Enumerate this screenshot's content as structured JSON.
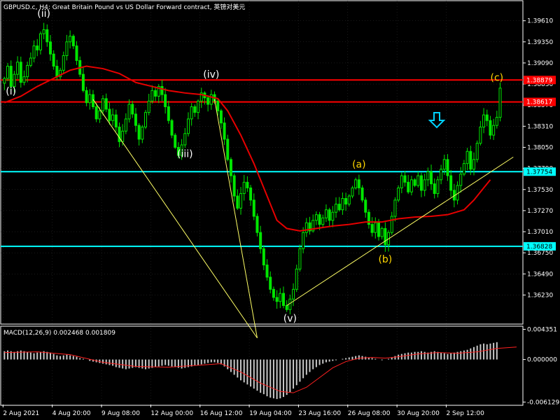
{
  "header": {
    "title": "GBPUSD.c, H4:  Great Britain Pound vs US Dollar Forward contract, 英镑对美元",
    "macd_label": "MACD(12,26,9) 0.002468 0.001809"
  },
  "colors": {
    "background": "#000000",
    "grid": "#333333",
    "frame": "#ffffff",
    "candle": "#00e600",
    "ma": "#e60000",
    "resistance": "#ff0000",
    "support": "#00ffff",
    "trend": "#ffff66",
    "wave_label_white": "#ffffff",
    "wave_label_yellow": "#ffd700",
    "arrow": "#00d2ff",
    "histogram": "#c8c8c8",
    "signal": "#ff2020"
  },
  "chart_data": {
    "type": "candlestick",
    "symbol": "GBPUSD.c",
    "timeframe": "H4",
    "price_axis": {
      "ylim": [
        1.3588,
        1.3984
      ],
      "ticks": [
        "1.39610",
        "1.39350",
        "1.39090",
        "1.38830",
        "1.38570",
        "1.38310",
        "1.38050",
        "1.37790",
        "1.37530",
        "1.37270",
        "1.37010",
        "1.36750",
        "1.36490",
        "1.36230"
      ]
    },
    "macd_axis": {
      "ylim": [
        -0.0065,
        0.0046
      ],
      "ticks": [
        "0.004351",
        "0.000000",
        "-0.006129"
      ]
    },
    "time_axis": {
      "labels": [
        "2 Aug 2021",
        "4 Aug 20:00",
        "9 Aug 08:00",
        "12 Aug 00:00",
        "16 Aug 12:00",
        "19 Aug 04:00",
        "23 Aug 16:00",
        "26 Aug 08:00",
        "30 Aug 20:00",
        "2 Sep 12:00"
      ]
    },
    "horizontal_lines": [
      {
        "price": 1.3888,
        "tag": "1.38879",
        "kind": "resistance"
      },
      {
        "price": 1.3861,
        "tag": "1.38617",
        "kind": "resistance"
      },
      {
        "price": 1.3775,
        "tag": "1.37754",
        "kind": "support"
      },
      {
        "price": 1.3683,
        "tag": "1.36828",
        "kind": "support"
      }
    ],
    "wave_labels": [
      {
        "text": "(i)",
        "index": 2,
        "price": 1.387,
        "color": "white"
      },
      {
        "text": "(ii)",
        "index": 12,
        "price": 1.3966,
        "color": "white"
      },
      {
        "text": "(iii)",
        "index": 55,
        "price": 1.3793,
        "color": "white"
      },
      {
        "text": "(iv)",
        "index": 63,
        "price": 1.3891,
        "color": "white"
      },
      {
        "text": "(v)",
        "index": 87,
        "price": 1.359,
        "color": "white"
      },
      {
        "text": "(a)",
        "index": 108,
        "price": 1.378,
        "color": "yellow"
      },
      {
        "text": "(b)",
        "index": 116,
        "price": 1.3663,
        "color": "yellow"
      },
      {
        "text": "(c)",
        "index": 150,
        "price": 1.3887,
        "color": "yellow"
      }
    ],
    "close": [
      1.389,
      1.3905,
      1.388,
      1.3895,
      1.391,
      1.3885,
      1.3892,
      1.3906,
      1.3915,
      1.393,
      1.3925,
      1.3945,
      1.395,
      1.3935,
      1.392,
      1.3905,
      1.3892,
      1.39,
      1.3918,
      1.3935,
      1.3942,
      1.393,
      1.3912,
      1.3895,
      1.3875,
      1.386,
      1.387,
      1.3855,
      1.384,
      1.385,
      1.3865,
      1.3852,
      1.3838,
      1.3845,
      1.383,
      1.3812,
      1.3825,
      1.384,
      1.3858,
      1.3846,
      1.3832,
      1.3815,
      1.383,
      1.3848,
      1.3862,
      1.3875,
      1.3868,
      1.388,
      1.387,
      1.3855,
      1.3838,
      1.382,
      1.3805,
      1.3795,
      1.3808,
      1.3822,
      1.384,
      1.3855,
      1.3848,
      1.3862,
      1.3872,
      1.3866,
      1.3858,
      1.387,
      1.3862,
      1.385,
      1.3835,
      1.3815,
      1.379,
      1.377,
      1.3745,
      1.373,
      1.3748,
      1.3762,
      1.3755,
      1.374,
      1.372,
      1.37,
      1.368,
      1.366,
      1.3645,
      1.363,
      1.362,
      1.3615,
      1.3625,
      1.361,
      1.3605,
      1.3618,
      1.363,
      1.3655,
      1.368,
      1.37,
      1.3712,
      1.3702,
      1.3715,
      1.3722,
      1.371,
      1.3718,
      1.3728,
      1.3715,
      1.3725,
      1.3735,
      1.3728,
      1.3742,
      1.3735,
      1.3745,
      1.3755,
      1.3765,
      1.3755,
      1.374,
      1.3725,
      1.371,
      1.37,
      1.3712,
      1.3695,
      1.3705,
      1.3685,
      1.37,
      1.372,
      1.374,
      1.3755,
      1.377,
      1.3762,
      1.375,
      1.3765,
      1.3758,
      1.377,
      1.3752,
      1.3765,
      1.3775,
      1.376,
      1.3748,
      1.3765,
      1.3778,
      1.379,
      1.377,
      1.3752,
      1.374,
      1.3758,
      1.3772,
      1.3785,
      1.38,
      1.3778,
      1.379,
      1.381,
      1.383,
      1.3845,
      1.3838,
      1.382,
      1.3832,
      1.3842,
      1.3878
    ],
    "ma_line": [
      [
        0,
        1.386
      ],
      [
        5,
        1.3868
      ],
      [
        10,
        1.388
      ],
      [
        15,
        1.389
      ],
      [
        20,
        1.39
      ],
      [
        25,
        1.3905
      ],
      [
        30,
        1.3902
      ],
      [
        35,
        1.3896
      ],
      [
        40,
        1.3885
      ],
      [
        45,
        1.388
      ],
      [
        50,
        1.3875
      ],
      [
        55,
        1.3872
      ],
      [
        60,
        1.387
      ],
      [
        65,
        1.3865
      ],
      [
        68,
        1.385
      ],
      [
        72,
        1.382
      ],
      [
        76,
        1.3785
      ],
      [
        80,
        1.3745
      ],
      [
        83,
        1.3715
      ],
      [
        86,
        1.3705
      ],
      [
        90,
        1.3702
      ],
      [
        95,
        1.3705
      ],
      [
        100,
        1.3708
      ],
      [
        105,
        1.371
      ],
      [
        110,
        1.3713
      ],
      [
        115,
        1.3713
      ],
      [
        120,
        1.3717
      ],
      [
        125,
        1.3719
      ],
      [
        130,
        1.372
      ],
      [
        135,
        1.3722
      ],
      [
        140,
        1.3728
      ],
      [
        143,
        1.374
      ],
      [
        146,
        1.3755
      ],
      [
        148,
        1.3765
      ]
    ],
    "trendlines": [
      [
        [
          27,
          1.3864
        ],
        [
          77,
          1.357
        ]
      ],
      [
        [
          64,
          1.3864
        ],
        [
          77,
          1.357
        ]
      ],
      [
        [
          86,
          1.361
        ],
        [
          155,
          1.3793
        ]
      ]
    ],
    "macd_histogram": [
      0.0012,
      0.0013,
      0.0012,
      0.0011,
      0.0012,
      0.0013,
      0.0012,
      0.0011,
      0.001,
      0.0009,
      0.001,
      0.0011,
      0.0012,
      0.0011,
      0.001,
      0.0008,
      0.0006,
      0.0005,
      0.0006,
      0.0007,
      0.0006,
      0.0005,
      0.0004,
      0.0002,
      0.0001,
      0.0,
      -0.0002,
      -0.0003,
      -0.0004,
      -0.0005,
      -0.0006,
      -0.0007,
      -0.0008,
      -0.0009,
      -0.0011,
      -0.0012,
      -0.0013,
      -0.0014,
      -0.0013,
      -0.0012,
      -0.0011,
      -0.0012,
      -0.0013,
      -0.0014,
      -0.0013,
      -0.0012,
      -0.0011,
      -0.001,
      -0.0009,
      -0.0008,
      -0.0009,
      -0.001,
      -0.0011,
      -0.0012,
      -0.0013,
      -0.0012,
      -0.0011,
      -0.001,
      -0.0009,
      -0.0008,
      -0.0007,
      -0.0006,
      -0.0005,
      -0.0004,
      -0.0004,
      -0.0005,
      -0.0007,
      -0.001,
      -0.0014,
      -0.0018,
      -0.0022,
      -0.0026,
      -0.003,
      -0.0033,
      -0.0036,
      -0.0039,
      -0.0042,
      -0.0045,
      -0.0048,
      -0.005,
      -0.0053,
      -0.0055,
      -0.0056,
      -0.0057,
      -0.0056,
      -0.0054,
      -0.0051,
      -0.0047,
      -0.0042,
      -0.0037,
      -0.0032,
      -0.0027,
      -0.0022,
      -0.0018,
      -0.0014,
      -0.0011,
      -0.0008,
      -0.0006,
      -0.0004,
      -0.0003,
      -0.0002,
      -0.0001,
      0.0,
      0.0001,
      0.0002,
      0.0003,
      0.0004,
      0.0005,
      0.0006,
      0.0005,
      0.0004,
      0.0003,
      0.0002,
      0.0001,
      0.0,
      -0.0001,
      0.0,
      0.0001,
      0.0003,
      0.0005,
      0.0007,
      0.0008,
      0.0009,
      0.001,
      0.001,
      0.0011,
      0.0011,
      0.0012,
      0.0011,
      0.001,
      0.0011,
      0.0012,
      0.0011,
      0.001,
      0.0009,
      0.0008,
      0.0009,
      0.001,
      0.0011,
      0.0012,
      0.0013,
      0.0014,
      0.0016,
      0.0018,
      0.002,
      0.0022,
      0.0023,
      0.0022,
      0.0023,
      0.0024,
      0.0025
    ],
    "macd_signal": [
      [
        0,
        0.001
      ],
      [
        10,
        0.0011
      ],
      [
        20,
        0.0007
      ],
      [
        30,
        -0.0004
      ],
      [
        40,
        -0.001
      ],
      [
        50,
        -0.0011
      ],
      [
        60,
        -0.0008
      ],
      [
        66,
        -0.0006
      ],
      [
        72,
        -0.0018
      ],
      [
        78,
        -0.0034
      ],
      [
        84,
        -0.0046
      ],
      [
        88,
        -0.0048
      ],
      [
        92,
        -0.004
      ],
      [
        96,
        -0.0026
      ],
      [
        100,
        -0.0012
      ],
      [
        104,
        -0.0003
      ],
      [
        108,
        0.0002
      ],
      [
        112,
        0.0003
      ],
      [
        116,
        0.0002
      ],
      [
        120,
        0.0004
      ],
      [
        126,
        0.0008
      ],
      [
        132,
        0.001
      ],
      [
        138,
        0.0009
      ],
      [
        144,
        0.0011
      ],
      [
        150,
        0.0016
      ],
      [
        156,
        0.0018
      ]
    ]
  }
}
